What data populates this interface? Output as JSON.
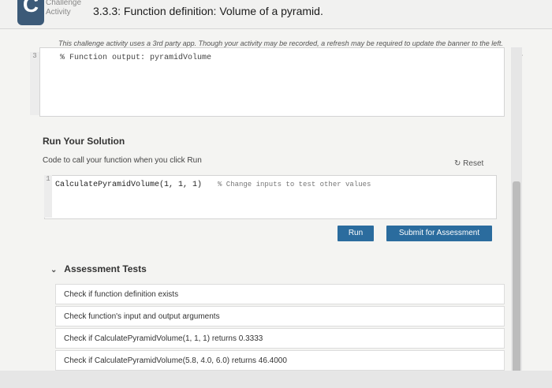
{
  "header": {
    "badge_letter": "C",
    "badge_label_line1": "Challenge",
    "badge_label_line2": "Activity",
    "title": "3.3.3: Function definition: Volume of a pyramid."
  },
  "intro_text": "This challenge activity uses a 3rd party app. Though your activity may be recorded, a refresh may be required to update the banner to the left.",
  "editor_top": {
    "line_number": "3",
    "code": "% Function output: pyramidVolume"
  },
  "run_section": {
    "heading": "Run Your Solution",
    "subtitle": "Code to call your function when you click Run",
    "reset_label": "Reset",
    "line_number": "1",
    "code": "CalculatePyramidVolume(1, 1, 1)",
    "comment": "% Change inputs to test other values",
    "run_label": "Run",
    "submit_label": "Submit for Assessment"
  },
  "assessment": {
    "heading": "Assessment Tests",
    "tests": [
      "Check if function definition exists",
      "Check function's input and output arguments",
      "Check if CalculatePyramidVolume(1, 1, 1) returns 0.3333",
      "Check if CalculatePyramidVolume(5.8, 4.0, 6.0) returns 46.4000"
    ]
  },
  "colors": {
    "accent": "#2b6c9e",
    "badge": "#3c5a78"
  }
}
